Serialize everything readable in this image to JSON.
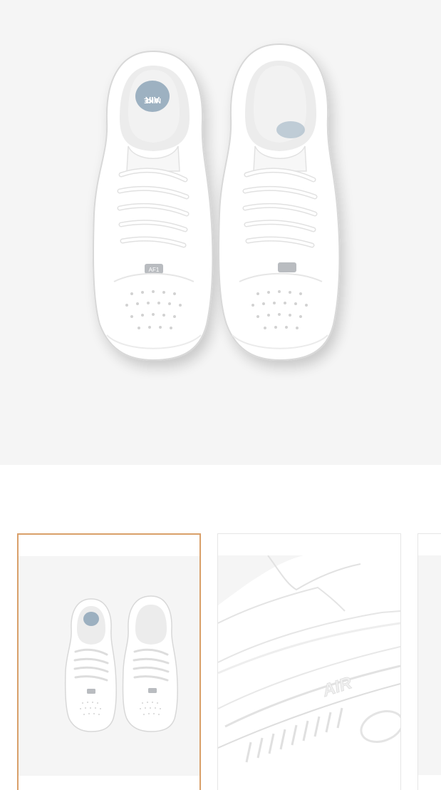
{
  "product": {
    "gallery": {
      "main_image": {
        "subject": "white sneakers top view",
        "tongue_label_lines": [
          "NIKE",
          "AIR"
        ],
        "aglet_text": "AF1"
      },
      "thumbnails": [
        {
          "subject": "white sneakers top view",
          "selected": true
        },
        {
          "subject": "heel close-up",
          "heel_text": "AIR",
          "selected": false
        },
        {
          "subject": "partial thumbnail",
          "selected": false
        }
      ],
      "selected_border_color": "#d9a06a",
      "background_color": "#f5f5f5"
    }
  }
}
